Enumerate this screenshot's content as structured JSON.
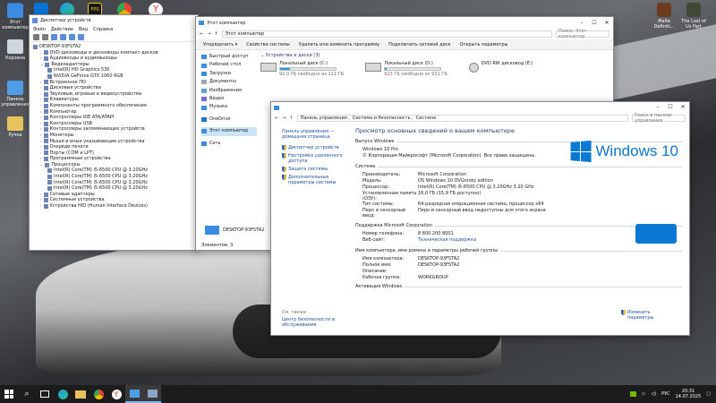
{
  "colors": {
    "accent": "#0078d7",
    "taskbar": "#1c1c1c",
    "link": "#1a4f9c",
    "progress": "#26a0da"
  },
  "top_apps": [
    {
      "label": "",
      "icon": "app-icon"
    },
    {
      "label": "",
      "icon": "windows-icon"
    },
    {
      "label": "",
      "icon": "edge-icon"
    },
    {
      "label": "",
      "icon": "fps-icon"
    },
    {
      "label": "",
      "icon": "chrome-icon"
    },
    {
      "label": "",
      "icon": "yandex-icon"
    },
    {
      "label": "Mafia Definiti...",
      "icon": "mafia-game-icon"
    },
    {
      "label": "The Last of Us Part",
      "icon": "tlou-game-icon"
    }
  ],
  "desktop_icons": [
    {
      "label": "Этот компьютер",
      "icon": "computer-icon"
    },
    {
      "label": "Корзина",
      "icon": "recycle-bin-icon"
    },
    {
      "label": "Панель управления",
      "icon": "control-panel-icon"
    },
    {
      "label": "Ручка",
      "icon": "folder-icon"
    }
  ],
  "device_manager": {
    "title": "Диспетчер устройств",
    "menu": [
      "Файл",
      "Действие",
      "Вид",
      "Справка"
    ],
    "tree": [
      {
        "level": 0,
        "label": "DESKTOP-93FSTA2"
      },
      {
        "level": 1,
        "label": "DVD-дисководы и дисководы компакт-дисков"
      },
      {
        "level": 1,
        "label": "Аудиовходы и аудиовыходы"
      },
      {
        "level": 1,
        "label": "Видеоадаптеры"
      },
      {
        "level": 2,
        "label": "Intel(R) HD Graphics 530"
      },
      {
        "level": 2,
        "label": "NVIDIA GeForce GTX 1060 6GB"
      },
      {
        "level": 1,
        "label": "Встроенное ПО"
      },
      {
        "level": 1,
        "label": "Дисковые устройства"
      },
      {
        "level": 1,
        "label": "Звуковые, игровые и видеоустройства"
      },
      {
        "level": 1,
        "label": "Клавиатуры"
      },
      {
        "level": 1,
        "label": "Компоненты программного обеспечения"
      },
      {
        "level": 1,
        "label": "Компьютер"
      },
      {
        "level": 1,
        "label": "Контроллеры IDE ATA/ATAPI"
      },
      {
        "level": 1,
        "label": "Контроллеры USB"
      },
      {
        "level": 1,
        "label": "Контроллеры запоминающих устройств"
      },
      {
        "level": 1,
        "label": "Мониторы"
      },
      {
        "level": 1,
        "label": "Мыши и иные указывающие устройства"
      },
      {
        "level": 1,
        "label": "Очереди печати"
      },
      {
        "level": 1,
        "label": "Порты (COM и LPT)"
      },
      {
        "level": 1,
        "label": "Программные устройства"
      },
      {
        "level": 1,
        "label": "Процессоры"
      },
      {
        "level": 2,
        "label": "Intel(R) Core(TM) i5-6500 CPU @ 3.20GHz"
      },
      {
        "level": 2,
        "label": "Intel(R) Core(TM) i5-6500 CPU @ 3.20GHz"
      },
      {
        "level": 2,
        "label": "Intel(R) Core(TM) i5-6500 CPU @ 3.20GHz"
      },
      {
        "level": 2,
        "label": "Intel(R) Core(TM) i5-6500 CPU @ 3.20GHz"
      },
      {
        "level": 1,
        "label": "Сетевые адаптеры"
      },
      {
        "level": 1,
        "label": "Системные устройства"
      },
      {
        "level": 1,
        "label": "Устройства HID (Human Interface Devices)"
      }
    ]
  },
  "explorer": {
    "title": "Этот компьютер",
    "ribbon": [
      "Упорядочить ▾",
      "Свойства системы",
      "Удалить или изменить программу",
      "Подключить сетевой диск",
      "Открыть параметры"
    ],
    "address": "Этот компьютер",
    "search_placeholder": "Поиск: Этот компьютер",
    "nav": [
      "Быстрый доступ",
      "Рабочий стол",
      "Загрузки",
      "Документы",
      "Изображения",
      "Видео",
      "Музыка",
      "OneDrive",
      "Этот компьютер",
      "Сеть"
    ],
    "section": "Устройства и диски (3)",
    "drives": [
      {
        "name": "Локальный диск (C:)",
        "free": "92,0 ГБ свободно из 111 ГБ",
        "used_fraction": 0.17
      },
      {
        "name": "Локальный диск (D:)",
        "free": "923 ГБ свободно из 931 ГБ",
        "used_fraction": 0.01
      }
    ],
    "dvd": "DVD RW дисковод (E:)",
    "pc_name": "DESKTOP-93FSTA2",
    "status": "Элементов: 3"
  },
  "system": {
    "title": "Система",
    "breadcrumb": [
      "Панель управления",
      "Система и безопасность",
      "Система"
    ],
    "search_placeholder": "Поиск в панели управления",
    "left_home": "Панель управления — домашняя страница",
    "left_links": [
      "Диспетчер устройств",
      "Настройка удаленного доступа",
      "Защита системы",
      "Дополнительные параметры системы"
    ],
    "see_also_title": "См. также",
    "see_also": "Центр безопасности и обслуживания",
    "heading": "Просмотр основных сведений о вашем компьютере",
    "edition_section": "Выпуск Windows",
    "edition": "Windows 10 Pro",
    "copyright": "© Корпорация Майкрософт (Microsoft Corporation). Все права защищены.",
    "logo_text": "Windows 10",
    "system_section": "Система",
    "system_rows": [
      {
        "k": "Производитель:",
        "v": "Microsoft Corporation"
      },
      {
        "k": "Модель:",
        "v": "OS Windows 10 OVGorsky edition"
      },
      {
        "k": "Процессор:",
        "v": "Intel(R) Core(TM) i5-6500 CPU @ 3.20GHz   3.20 GHz"
      },
      {
        "k": "Установленная память (ОЗУ):",
        "v": "16,0 ГБ (15,9 ГБ доступно)"
      },
      {
        "k": "Тип системы:",
        "v": "64-разрядная операционная система, процессор x64"
      },
      {
        "k": "Перо и сенсорный ввод:",
        "v": "Перо и сенсорный ввод недоступны для этого экрана"
      }
    ],
    "support_section": "Поддержка Microsoft Corporation",
    "support_rows": [
      {
        "k": "Номер телефона:",
        "v": "8 800 200 8001"
      },
      {
        "k": "Веб-сайт:",
        "v": "Техническая поддержка"
      }
    ],
    "name_section": "Имя компьютера, имя домена и параметры рабочей группы",
    "name_rows": [
      {
        "k": "Имя компьютера:",
        "v": "DESKTOP-93FSTA2"
      },
      {
        "k": "Полное имя:",
        "v": "DESKTOP-93FSTA2"
      },
      {
        "k": "Описание:",
        "v": ""
      },
      {
        "k": "Рабочая группа:",
        "v": "WORKGROUP"
      }
    ],
    "change_params": "Изменить параметры",
    "activation_section": "Активация Windows"
  },
  "taskbar": {
    "lang": "РУС",
    "time": "20:31",
    "date": "14.07.2025"
  }
}
